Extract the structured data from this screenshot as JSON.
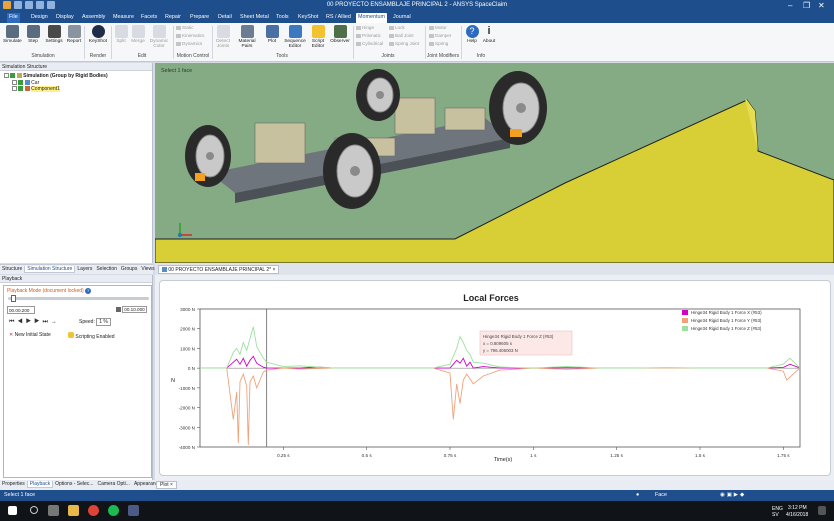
{
  "titlebar": {
    "title": "00 PROYECTO ENSAMBLAJE PRINCIPAL 2 - ANSYS SpaceClaim"
  },
  "menu": {
    "tabs": [
      "File",
      "Design",
      "Display",
      "Assembly",
      "Measure",
      "Facets",
      "Repair",
      "Prepare",
      "Detail",
      "Sheet Metal",
      "Tools",
      "KeyShot",
      "RS / Allied",
      "Momentum",
      "Journal"
    ],
    "active": "Momentum"
  },
  "ribbon": {
    "simulate": "Simulate",
    "step": "Step",
    "settings": "Settings",
    "report": "Report",
    "keyshot": "KeyShot",
    "render": "Render",
    "split": "Split",
    "merge": "Merge",
    "dynamic_color": "Dynamic Color",
    "static": "Static",
    "kinematics": "Kinematics",
    "dynamics": "Dynamics",
    "detect_joints": "Detect Joints",
    "material_pairs": "Material Pairs",
    "plot": "Plot",
    "sequence_editor": "Sequence Editor",
    "script_editor": "Script Editor",
    "observer": "Observer",
    "hinge": "Hinge",
    "prismatic": "Prismatic",
    "cylindrical": "Cylindrical",
    "lock": "Lock",
    "ball_joint": "Ball Joint",
    "spring_joint": "Spring Joint",
    "motor": "Motor",
    "damper": "Damper",
    "spring": "Spring",
    "help": "Help",
    "about": "About",
    "groups": {
      "simulation": "Simulation",
      "render": "Render",
      "edit": "Edit",
      "motion_control": "Motion Control",
      "tools": "Tools",
      "joints": "Joints",
      "joint_modifiers": "Joint Modifiers",
      "info": "Info"
    }
  },
  "structure": {
    "title": "Simulation Structure",
    "root": "Simulation (Group by Rigid Bodies)",
    "items": [
      "Car",
      "Component1"
    ],
    "tabs": [
      "Structure",
      "Simulation Structure",
      "Layers",
      "Selection",
      "Groups",
      "Views"
    ]
  },
  "playback": {
    "title": "Playback",
    "mode": "Playback Mode (document locked)",
    "start_time": "00.00.200",
    "end_time": "00.10.000",
    "speed_label": "Speed:",
    "speed_value": "1 %",
    "new_initial_state": "New Initial State",
    "scripting": "Scripting Enabled"
  },
  "viewport": {
    "hint": "Select 1 face"
  },
  "doc_tab": {
    "label": "00 PROYECTO ENSAMBLAJE PRINCIPAL 2*"
  },
  "chart_data": {
    "type": "line",
    "title": "Local Forces",
    "xlabel": "Time(s)",
    "ylabel": "N",
    "xlim": [
      0,
      1.8
    ],
    "ylim": [
      -4000,
      3000
    ],
    "yticks": [
      "3000 N",
      "2000 N",
      "1000 N",
      "0 N",
      "-1000 N",
      "-2000 N",
      "-3000 N",
      "-4000 N"
    ],
    "xticks": [
      "0.25 s",
      "0.5 s",
      "0.75 s",
      "1 s",
      "1.25 s",
      "1.5 s",
      "1.75 s"
    ],
    "cursor_x": 0.2,
    "series": [
      {
        "name": "Hinge34 Rigid Body 1 Force X (#53)",
        "color": "#d400c8",
        "x": [
          0,
          0.08,
          0.1,
          0.11,
          0.12,
          0.13,
          0.14,
          0.15,
          0.16,
          0.17,
          0.18,
          0.19,
          0.2,
          0.25,
          0.3,
          0.35,
          0.4,
          0.5,
          0.6,
          0.7,
          0.75,
          0.77,
          0.78,
          0.79,
          0.8,
          0.81,
          0.82,
          0.85,
          0.9,
          0.95,
          1.0,
          1.1,
          1.2,
          1.3,
          1.4,
          1.5,
          1.6,
          1.7,
          1.75,
          1.77,
          1.8
        ],
        "values": [
          0,
          0,
          300,
          450,
          200,
          500,
          100,
          400,
          600,
          250,
          150,
          50,
          0,
          0,
          0,
          60,
          0,
          0,
          0,
          0,
          0,
          400,
          250,
          500,
          100,
          300,
          0,
          80,
          0,
          0,
          0,
          20,
          0,
          0,
          10,
          0,
          0,
          0,
          40,
          200,
          0
        ]
      },
      {
        "name": "Hinge34 Rigid Body 1 Force Y (#53)",
        "color": "#f0a27a",
        "x": [
          0,
          0.08,
          0.1,
          0.11,
          0.115,
          0.12,
          0.13,
          0.14,
          0.145,
          0.15,
          0.16,
          0.17,
          0.18,
          0.19,
          0.2,
          0.25,
          0.3,
          0.4,
          0.5,
          0.6,
          0.7,
          0.75,
          0.76,
          0.77,
          0.78,
          0.79,
          0.8,
          0.82,
          0.85,
          0.9,
          1.0,
          1.1,
          1.2,
          1.3,
          1.4,
          1.5,
          1.6,
          1.7,
          1.75,
          1.76,
          1.8
        ],
        "values": [
          0,
          0,
          -2600,
          -1200,
          -3800,
          -700,
          -300,
          -900,
          -3900,
          -700,
          -400,
          -1000,
          -600,
          -200,
          -100,
          0,
          -50,
          0,
          0,
          0,
          0,
          -250,
          -2600,
          -800,
          -1800,
          -600,
          -300,
          -800,
          -400,
          -100,
          0,
          -60,
          0,
          0,
          0,
          0,
          0,
          0,
          -150,
          -600,
          0
        ]
      },
      {
        "name": "Hinge34 Rigid Body 1 Force Z (#53)",
        "color": "#9ee09e",
        "x": [
          0,
          0.08,
          0.1,
          0.11,
          0.12,
          0.13,
          0.14,
          0.15,
          0.16,
          0.17,
          0.18,
          0.19,
          0.2,
          0.25,
          0.3,
          0.4,
          0.5,
          0.6,
          0.7,
          0.75,
          0.77,
          0.78,
          0.79,
          0.8,
          0.81,
          0.82,
          0.85,
          0.9,
          1.0,
          1.1,
          1.2,
          1.3,
          1.4,
          1.5,
          1.6,
          1.7,
          1.75,
          1.77,
          1.8
        ],
        "values": [
          0,
          0,
          800,
          1000,
          700,
          1300,
          900,
          1500,
          2100,
          1100,
          800,
          500,
          300,
          80,
          120,
          0,
          0,
          0,
          0,
          200,
          1000,
          1600,
          1300,
          900,
          700,
          300,
          250,
          60,
          0,
          90,
          0,
          0,
          30,
          0,
          0,
          0,
          200,
          500,
          0
        ]
      }
    ],
    "tooltip": {
      "line1": "Hinge34 Rigid Body 1 Force Z (#53)",
      "line2": "x = 0.809605 s",
      "line3": "y = 796.406003 N"
    }
  },
  "bottom_tabs": [
    "Properties",
    "Playback",
    "Options - Selec...",
    "Camera Opti...",
    "Appearance"
  ],
  "plot_tab": "Plot",
  "status": {
    "left": "Select 1 face",
    "mode": "Face"
  },
  "taskbar": {
    "lang": "ENG",
    "time": "3:12 PM",
    "date": "4/16/2018",
    "region": "SV"
  }
}
